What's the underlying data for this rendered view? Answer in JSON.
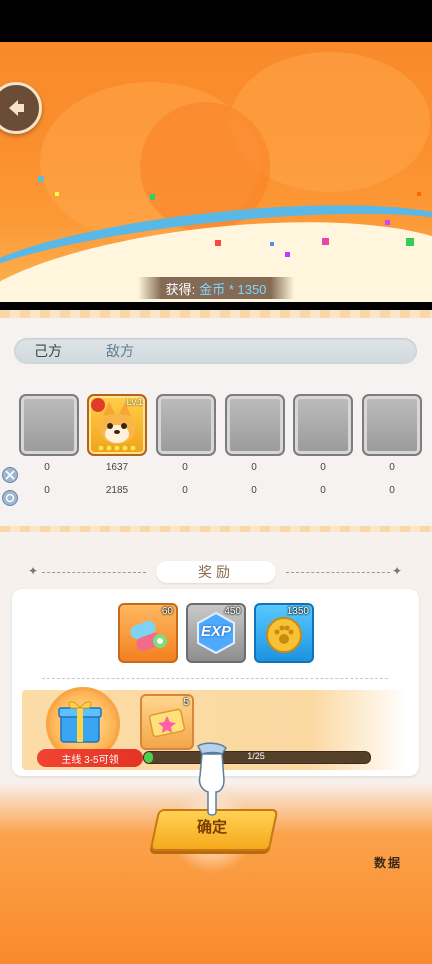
{
  "header": {
    "back_icon": "back-arrow-icon"
  },
  "gain": {
    "label": "获得:",
    "value": "金币 * 1350"
  },
  "tabs": [
    {
      "label": "己方"
    },
    {
      "label": "敌方"
    }
  ],
  "heroes": [
    {
      "slot": "empty",
      "damage": "0",
      "taken": "0"
    },
    {
      "slot": "fox-hero",
      "level": "Lv.1",
      "damage": "1637",
      "taken": "2185"
    },
    {
      "slot": "empty",
      "damage": "0",
      "taken": "0"
    },
    {
      "slot": "empty",
      "damage": "0",
      "taken": "0"
    },
    {
      "slot": "empty",
      "damage": "0",
      "taken": "0"
    },
    {
      "slot": "empty",
      "damage": "0",
      "taken": "0"
    }
  ],
  "rewards": {
    "title": "奖励",
    "items": [
      {
        "icon": "tape-rolls-icon",
        "count": "60"
      },
      {
        "icon": "exp-crystal-icon",
        "label": "EXP",
        "count": "450"
      },
      {
        "icon": "paw-coin-icon",
        "count": "1350"
      }
    ]
  },
  "quest": {
    "label": "主线 3-5可领",
    "ticket_count": "5",
    "progress_text": "1/25",
    "progress_fraction": 0.04
  },
  "confirm_label": "确定",
  "data_label": "数据",
  "colors": {
    "accent": "#f98a2b",
    "progress": "#4fcf4b"
  }
}
